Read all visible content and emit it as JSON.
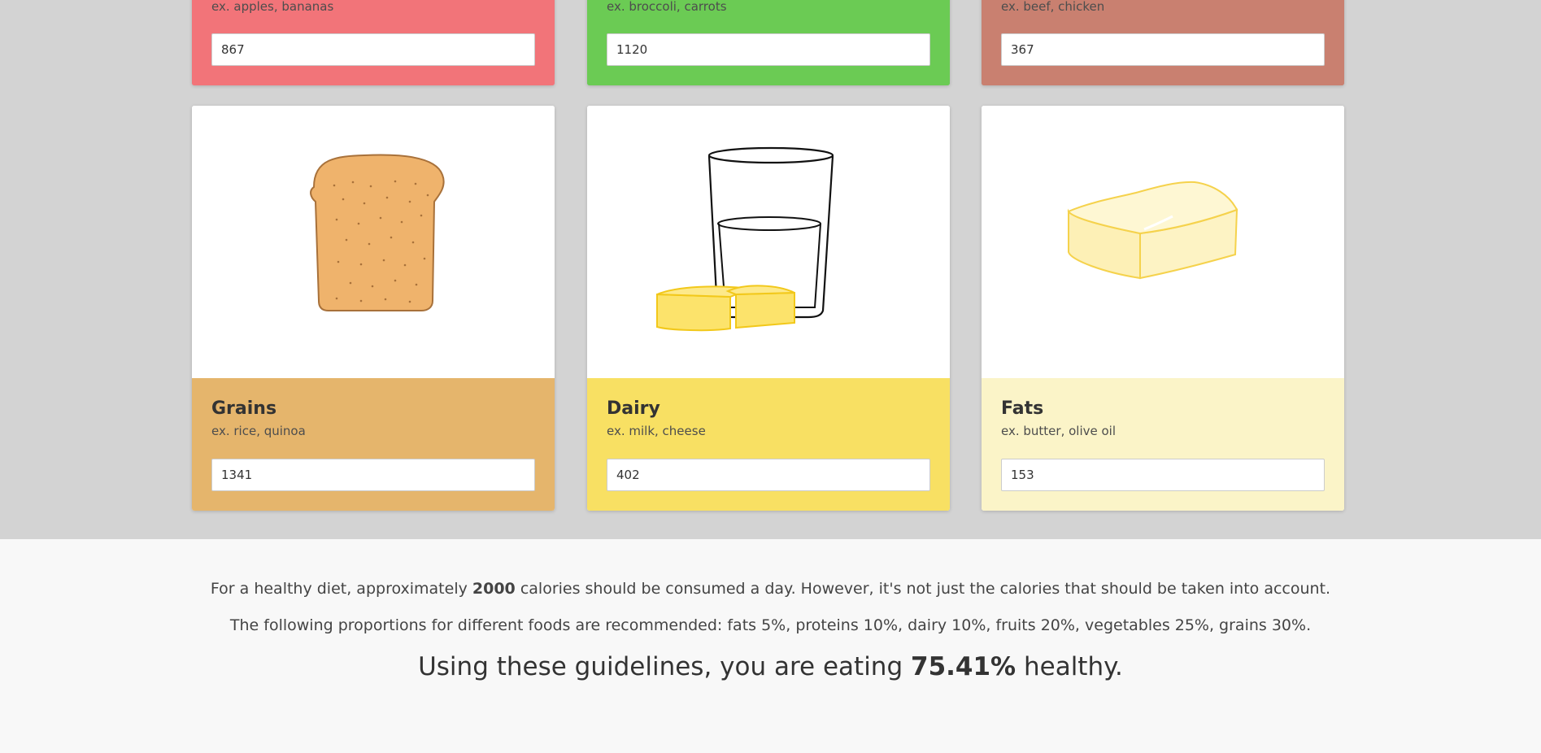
{
  "cards_top": [
    {
      "example": "ex. apples, bananas",
      "value": "867",
      "color": "#f27479"
    },
    {
      "example": "ex. broccoli, carrots",
      "value": "1120",
      "color": "#6bcb54"
    },
    {
      "example": "ex. beef, chicken",
      "value": "367",
      "color": "#c98070"
    }
  ],
  "cards": [
    {
      "title": "Grains",
      "example": "ex. rice, quinoa",
      "value": "1341",
      "color": "#e5b56c",
      "icon": "bread-icon"
    },
    {
      "title": "Dairy",
      "example": "ex. milk, cheese",
      "value": "402",
      "color": "#f8e063",
      "icon": "milk-cheese-icon"
    },
    {
      "title": "Fats",
      "example": "ex. butter, olive oil",
      "value": "153",
      "color": "#fbf4c8",
      "icon": "butter-icon"
    }
  ],
  "summary": {
    "line1_pre": "For a healthy diet, approximately ",
    "line1_bold": "2000",
    "line1_post": " calories should be consumed a day. However, it's not just the calories that should be taken into account.",
    "line2": "The following proportions for different foods are recommended: fats 5%, proteins 10%, dairy 10%, fruits 20%, vegetables 25%, grains 30%.",
    "line3_pre": "Using these guidelines, you are eating ",
    "line3_bold": "75.41%",
    "line3_post": " healthy."
  }
}
